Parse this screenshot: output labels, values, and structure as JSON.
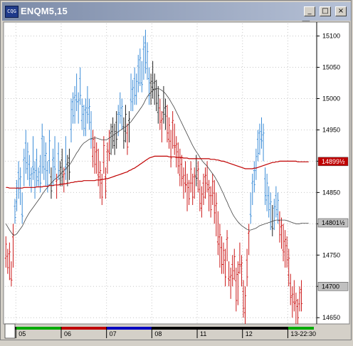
{
  "window": {
    "title": "ENQM5,15",
    "icon_name": "chart-app-icon",
    "icon_text": "CQG",
    "minimize_icon": "minimize-icon",
    "maximize_icon": "maximize-icon",
    "close_icon": "close-icon",
    "minimize_glyph": "_",
    "maximize_glyph": "□",
    "close_glyph": "×"
  },
  "chart_data": {
    "type": "bar",
    "subtype": "ohlc-price-bars",
    "symbol": "ENQM5",
    "interval": "15",
    "ylim": [
      14640,
      15120
    ],
    "y_ticks": [
      14650,
      14700,
      14750,
      14800,
      14850,
      14900,
      14950,
      15000,
      15050,
      15100
    ],
    "y_tick_labels": [
      "14650",
      "14700",
      "14750",
      "14800",
      "14850",
      "14900",
      "14950",
      "15000",
      "15050",
      "15100"
    ],
    "price_markers": [
      {
        "label": "14899½",
        "value": 14899.5,
        "color": "#c00000",
        "text_color": "#ffffff"
      },
      {
        "label": "14801½",
        "value": 14801.5,
        "color": "#c0c0c0",
        "text_color": "#000000"
      },
      {
        "label": "14700",
        "value": 14700,
        "color": "#c0c0c0",
        "text_color": "#000000"
      }
    ],
    "x_labels": [
      {
        "label": "05",
        "bar": 6
      },
      {
        "label": "06",
        "bar": 31
      },
      {
        "label": "07",
        "bar": 56
      },
      {
        "label": "08",
        "bar": 81
      },
      {
        "label": "11",
        "bar": 106
      },
      {
        "label": "12",
        "bar": 131
      },
      {
        "label": "13-22:30",
        "bar": 156
      }
    ],
    "session_colors": [
      "#00aa00",
      "#c00000",
      "#0000c0",
      "#000000",
      "#000000",
      "#000000",
      "#00aa00"
    ],
    "colors": {
      "up": "#3c8dd8",
      "down": "#cc1b1b",
      "neutral": "#222222",
      "ma_fast": "#444444",
      "ma_slow": "#c00000",
      "grid": "#c8c8c8"
    },
    "grid": true,
    "bar_count": 168,
    "highs": [
      14780,
      14760,
      14770,
      14740,
      14800,
      14840,
      14870,
      14900,
      14890,
      14850,
      14920,
      14950,
      14930,
      14910,
      14890,
      14940,
      14900,
      14920,
      14890,
      14910,
      14960,
      14940,
      14930,
      14900,
      14950,
      14890,
      14920,
      14940,
      14880,
      14930,
      14900,
      14920,
      14890,
      14940,
      14910,
      14920,
      15000,
      15010,
      15020,
      15040,
      15010,
      15050,
      15000,
      14990,
      15000,
      15020,
      15000,
      14980,
      14950,
      14940,
      14930,
      14920,
      14900,
      14880,
      14940,
      14890,
      14930,
      14950,
      14960,
      14970,
      14960,
      14980,
      14990,
      15010,
      15000,
      14970,
      14990,
      14960,
      14980,
      15040,
      15030,
      15050,
      15040,
      15070,
      15080,
      15060,
      15100,
      15110,
      15090,
      15050,
      15040,
      15060,
      15040,
      15030,
      15020,
      15000,
      14980,
      15020,
      15000,
      14990,
      14970,
      14950,
      14980,
      14960,
      14940,
      14930,
      14920,
      14910,
      14890,
      14900,
      14880,
      14870,
      14900,
      14880,
      14890,
      14910,
      14900,
      14870,
      14860,
      14880,
      14890,
      14900,
      14870,
      14860,
      14880,
      14870,
      14850,
      14820,
      14800,
      14780,
      14770,
      14760,
      14790,
      14740,
      14730,
      14750,
      14760,
      14730,
      14740,
      14770,
      14750,
      14710,
      14700,
      14760,
      14800,
      14850,
      14880,
      14900,
      14920,
      14950,
      14960,
      14970,
      14960,
      14890,
      14880,
      14860,
      14850,
      14830,
      14840,
      14860,
      14850,
      14820,
      14810,
      14800,
      14790,
      14780,
      14760,
      14720,
      14700,
      14710,
      14690,
      14680,
      14700,
      14710
    ],
    "lows": [
      14730,
      14720,
      14710,
      14700,
      14730,
      14800,
      14820,
      14840,
      14830,
      14800,
      14860,
      14880,
      14870,
      14860,
      14850,
      14870,
      14840,
      14860,
      14860,
      14850,
      14880,
      14870,
      14860,
      14850,
      14880,
      14840,
      14860,
      14870,
      14840,
      14870,
      14860,
      14860,
      14850,
      14870,
      14860,
      14870,
      14930,
      14960,
      14960,
      14980,
      14960,
      14990,
      14950,
      14940,
      14940,
      14960,
      14950,
      14920,
      14890,
      14880,
      14880,
      14860,
      14840,
      14830,
      14880,
      14840,
      14880,
      14900,
      14910,
      14920,
      14910,
      14920,
      14940,
      14960,
      14950,
      14920,
      14930,
      14910,
      14930,
      14980,
      14980,
      14990,
      14990,
      15010,
      15020,
      15010,
      15030,
      15040,
      15030,
      14990,
      14990,
      15000,
      14990,
      14980,
      14960,
      14950,
      14930,
      14960,
      14950,
      14930,
      14920,
      14890,
      14920,
      14910,
      14890,
      14880,
      14860,
      14860,
      14840,
      14850,
      14820,
      14830,
      14850,
      14830,
      14840,
      14860,
      14850,
      14820,
      14810,
      14830,
      14840,
      14850,
      14820,
      14810,
      14830,
      14800,
      14780,
      14750,
      14730,
      14720,
      14720,
      14700,
      14740,
      14700,
      14680,
      14700,
      14710,
      14660,
      14670,
      14720,
      14700,
      14650,
      14640,
      14700,
      14750,
      14800,
      14830,
      14850,
      14870,
      14900,
      14910,
      14920,
      14900,
      14830,
      14820,
      14810,
      14790,
      14780,
      14790,
      14810,
      14800,
      14770,
      14760,
      14740,
      14730,
      14730,
      14700,
      14670,
      14650,
      14660,
      14640,
      14640,
      14660,
      14660
    ],
    "ma_fast": [
      14800,
      14795,
      14790,
      14786,
      14782,
      14782,
      14784,
      14788,
      14792,
      14796,
      14802,
      14808,
      14813,
      14818,
      14822,
      14826,
      14830,
      14834,
      14838,
      14842,
      14847,
      14851,
      14855,
      14858,
      14862,
      14865,
      14868,
      14871,
      14873,
      14876,
      14879,
      14882,
      14885,
      14888,
      14891,
      14894,
      14898,
      14903,
      14908,
      14913,
      14917,
      14922,
      14926,
      14929,
      14931,
      14933,
      14935,
      14936,
      14937,
      14937,
      14937,
      14936,
      14935,
      14934,
      14934,
      14934,
      14935,
      14937,
      14939,
      14941,
      14943,
      14945,
      14947,
      14949,
      14951,
      14953,
      14955,
      14957,
      14960,
      14963,
      14967,
      14971,
      14975,
      14979,
      14983,
      14987,
      14992,
      14998,
      15003,
      15007,
      15010,
      15013,
      15015,
      15016,
      15016,
      15015,
      15013,
      15011,
      15008,
      15004,
      15000,
      14995,
      14990,
      14985,
      14979,
      14973,
      14967,
      14961,
      14955,
      14949,
      14943,
      14937,
      14931,
      14925,
      14920,
      14915,
      14911,
      14906,
      14902,
      14898,
      14895,
      14892,
      14888,
      14884,
      14880,
      14876,
      14871,
      14866,
      14860,
      14854,
      14848,
      14841,
      14835,
      14828,
      14822,
      14816,
      14811,
      14807,
      14803,
      14800,
      14797,
      14795,
      14793,
      14791,
      14790,
      14790,
      14791,
      14792,
      14793,
      14795,
      14797,
      14798,
      14799,
      14800,
      14801,
      14802,
      14803,
      14804,
      14805,
      14806,
      14806,
      14806,
      14806,
      14806,
      14806,
      14805,
      14804,
      14803,
      14802,
      14801,
      14800,
      14800,
      14800,
      14801,
      14801,
      14801,
      14801,
      14801
    ],
    "ma_slow": [
      14858,
      14858,
      14857,
      14857,
      14857,
      14857,
      14857,
      14857,
      14857,
      14857,
      14858,
      14858,
      14858,
      14858,
      14858,
      14858,
      14858,
      14859,
      14859,
      14859,
      14859,
      14860,
      14860,
      14860,
      14861,
      14861,
      14861,
      14862,
      14862,
      14862,
      14863,
      14863,
      14864,
      14864,
      14865,
      14865,
      14866,
      14866,
      14867,
      14867,
      14868,
      14868,
      14868,
      14869,
      14869,
      14869,
      14869,
      14869,
      14869,
      14869,
      14870,
      14870,
      14870,
      14871,
      14871,
      14872,
      14872,
      14873,
      14874,
      14875,
      14876,
      14877,
      14878,
      14879,
      14880,
      14881,
      14882,
      14883,
      14885,
      14886,
      14888,
      14889,
      14891,
      14893,
      14895,
      14897,
      14899,
      14901,
      14903,
      14905,
      14906,
      14907,
      14908,
      14908,
      14908,
      14908,
      14908,
      14908,
      14908,
      14908,
      14907,
      14907,
      14907,
      14907,
      14906,
      14906,
      14906,
      14906,
      14905,
      14905,
      14905,
      14904,
      14904,
      14904,
      14904,
      14904,
      14904,
      14904,
      14904,
      14904,
      14904,
      14904,
      14904,
      14903,
      14903,
      14903,
      14902,
      14902,
      14901,
      14900,
      14900,
      14899,
      14898,
      14897,
      14896,
      14895,
      14894,
      14893,
      14892,
      14891,
      14890,
      14889,
      14888,
      14888,
      14888,
      14888,
      14888,
      14889,
      14889,
      14890,
      14891,
      14892,
      14893,
      14894,
      14895,
      14896,
      14897,
      14898,
      14898,
      14899,
      14899,
      14900,
      14900,
      14900,
      14900,
      14900,
      14900,
      14900,
      14900,
      14900,
      14900,
      14899,
      14899,
      14899,
      14899,
      14899,
      14899,
      14899
    ]
  }
}
